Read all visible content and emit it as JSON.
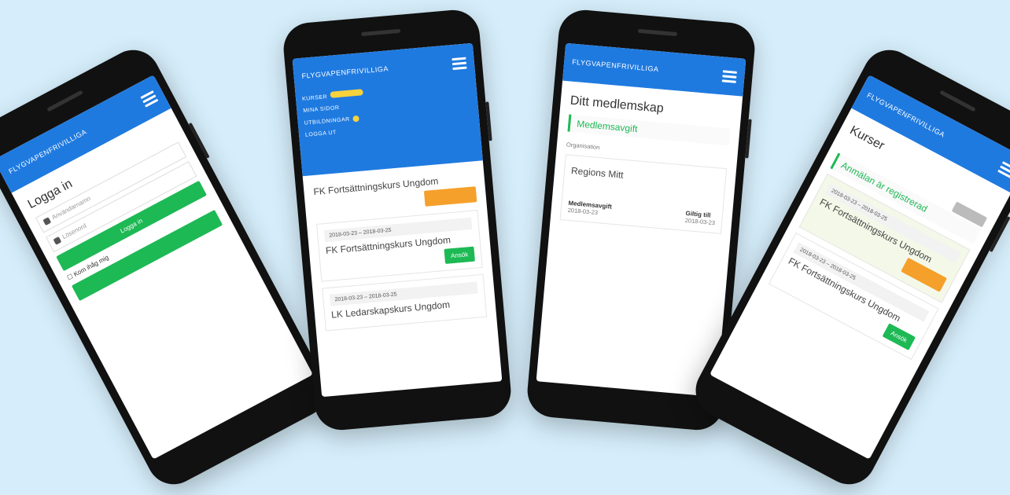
{
  "brand": "FLYGVAPENFRIVILLIGA",
  "colors": {
    "primary": "#1f7ae0",
    "success": "#1db954",
    "warning": "#f5a02a",
    "badge": "#f6d33a",
    "background": "#d6eefb"
  },
  "login": {
    "title": "Logga in",
    "username_placeholder": "Användarnamn",
    "password_placeholder": "Lösenord",
    "remember": "Kom ihåg mig",
    "submit": "Logga in"
  },
  "menu": {
    "items": [
      "KURSER",
      "MINA SIDOR",
      "UTBILDNINGAR",
      "LOGGA UT"
    ],
    "badge": ""
  },
  "courses_page": {
    "card1_title": "FK Fortsättningskurs Ungdom",
    "card1_orange": "",
    "card2_date": "2018-03-23 – 2018-03-25",
    "card2_title": "FK Fortsättningskurs Ungdom",
    "card2_button": "Ansök",
    "card3_date": "2018-03-23 – 2018-03-25",
    "card3_title": "LK Ledarskapskurs Ungdom"
  },
  "membership": {
    "title": "Ditt medlemskap",
    "alert_title": "Medlemsavgift",
    "org_label": "Organisation",
    "region": "Regions Mitt",
    "fee_label": "Medlemsavgift",
    "fee_date": "2018-03-23",
    "valid_label": "Giltig till",
    "valid_date": "2018-03-23"
  },
  "courses2": {
    "title": "Kurser",
    "alert_title": "Anmälan är registrerad",
    "date": "2018-03-23 – 2018-03-25",
    "card_title": "FK Fortsättningskurs Ungdom",
    "date2": "2018-03-23 – 2018-03-25",
    "card2_title": "FK Fortsättningskurs Ungdom",
    "button": "Ansök"
  }
}
